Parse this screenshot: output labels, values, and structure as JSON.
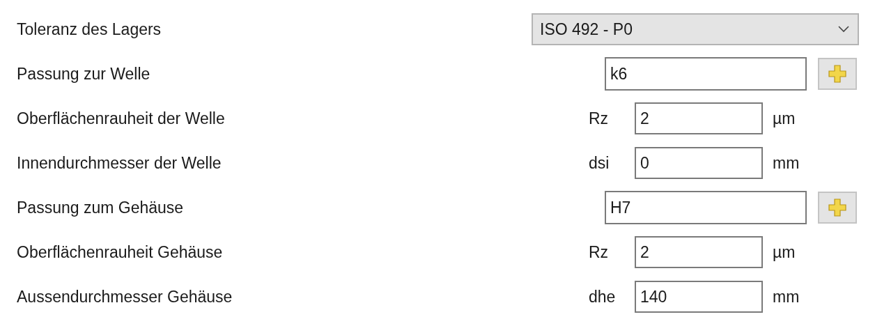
{
  "rows": [
    {
      "kind": "select",
      "label": "Toleranz des Lagers",
      "value": "ISO 492 - P0"
    },
    {
      "kind": "fit",
      "label": "Passung zur Welle",
      "value": "k6"
    },
    {
      "kind": "measure",
      "label": "Oberflächenrauheit der Welle",
      "symbol": "Rz",
      "value": "2",
      "unit": "µm"
    },
    {
      "kind": "measure",
      "label": "Innendurchmesser der Welle",
      "symbol": "dsi",
      "value": "0",
      "unit": "mm"
    },
    {
      "kind": "fit",
      "label": "Passung zum Gehäuse",
      "value": "H7"
    },
    {
      "kind": "measure",
      "label": "Oberflächenrauheit Gehäuse",
      "symbol": "Rz",
      "value": "2",
      "unit": "µm"
    },
    {
      "kind": "measure",
      "label": "Aussendurchmesser Gehäuse",
      "symbol": "dhe",
      "value": "140",
      "unit": "mm"
    }
  ]
}
